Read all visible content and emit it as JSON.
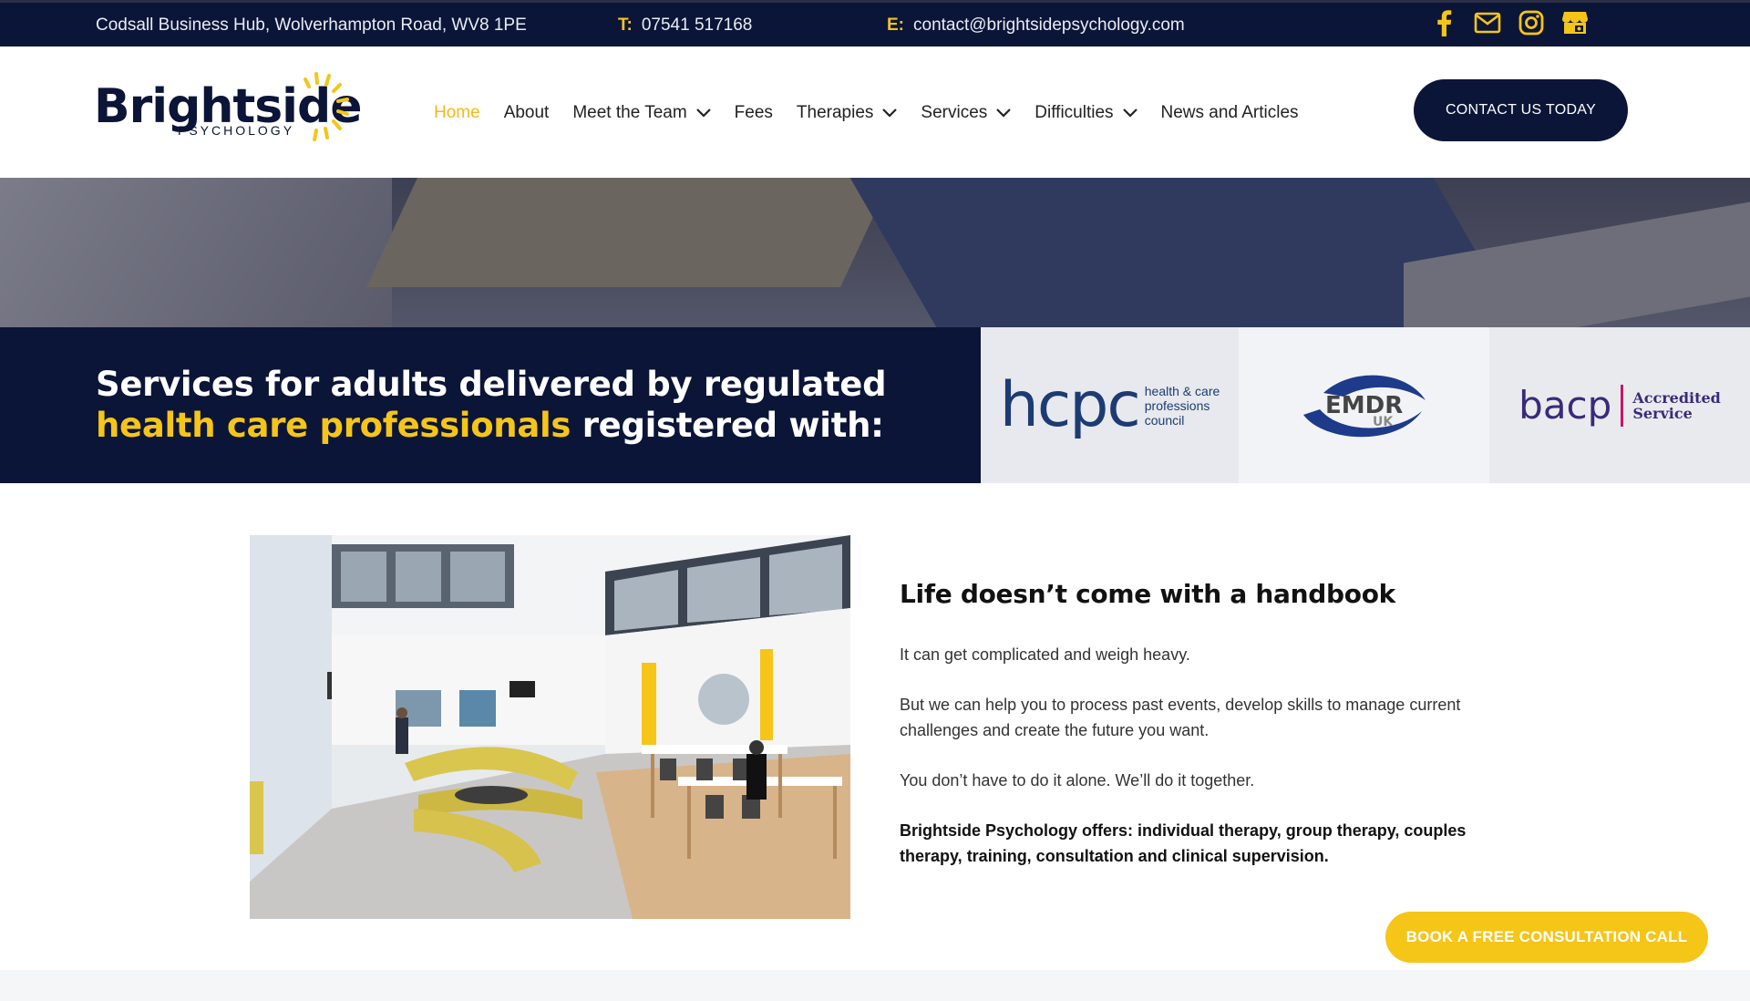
{
  "topbar": {
    "address": "Codsall Business Hub, Wolverhampton Road, WV8 1PE",
    "phone_label": "T:",
    "phone": "07541 517168",
    "email_label": "E:",
    "email": "contact@brightsidepsychology.com",
    "icons": [
      "facebook-icon",
      "mail-icon",
      "instagram-icon",
      "google-business-icon"
    ]
  },
  "header": {
    "logo_word": "Brightside",
    "logo_sub": "PSYCHOLOGY",
    "nav": [
      {
        "label": "Home",
        "active": true,
        "dropdown": false
      },
      {
        "label": "About",
        "active": false,
        "dropdown": false
      },
      {
        "label": "Meet the Team",
        "active": false,
        "dropdown": true
      },
      {
        "label": "Fees",
        "active": false,
        "dropdown": false
      },
      {
        "label": "Therapies",
        "active": false,
        "dropdown": true
      },
      {
        "label": "Services",
        "active": false,
        "dropdown": true
      },
      {
        "label": "Difficulties",
        "active": false,
        "dropdown": true
      },
      {
        "label": "News and Articles",
        "active": false,
        "dropdown": false
      }
    ],
    "cta": "CONTACT US TODAY"
  },
  "band": {
    "text_before": "Services for adults delivered by regulated ",
    "highlight": "health care professionals",
    "text_after": " registered with:"
  },
  "accreditations": {
    "hcpc_big": "hcpc",
    "hcpc_small_1": "health & care",
    "hcpc_small_2": "professions",
    "hcpc_small_3": "council",
    "emdr_big": "EMDR",
    "emdr_small": "UK",
    "bacp_big": "bacp",
    "bacp_small_1": "Accredited",
    "bacp_small_2": "Service"
  },
  "main": {
    "heading": "Life doesn’t come with a handbook",
    "p1": "It can get complicated and weigh heavy.",
    "p2": "But we can help you to process past events, develop skills to manage current challenges and create the future you want.",
    "p3": "You don’t have to do it alone. We’ll do it together.",
    "p4": "Brightside Psychology offers: individual therapy, group therapy, couples therapy, training, consultation and clinical supervision."
  },
  "cta_bottom": "BOOK A FREE CONSULTATION CALL",
  "colors": {
    "navy": "#0b1537",
    "yellow": "#f5c518",
    "active_nav": "#f5b918"
  }
}
